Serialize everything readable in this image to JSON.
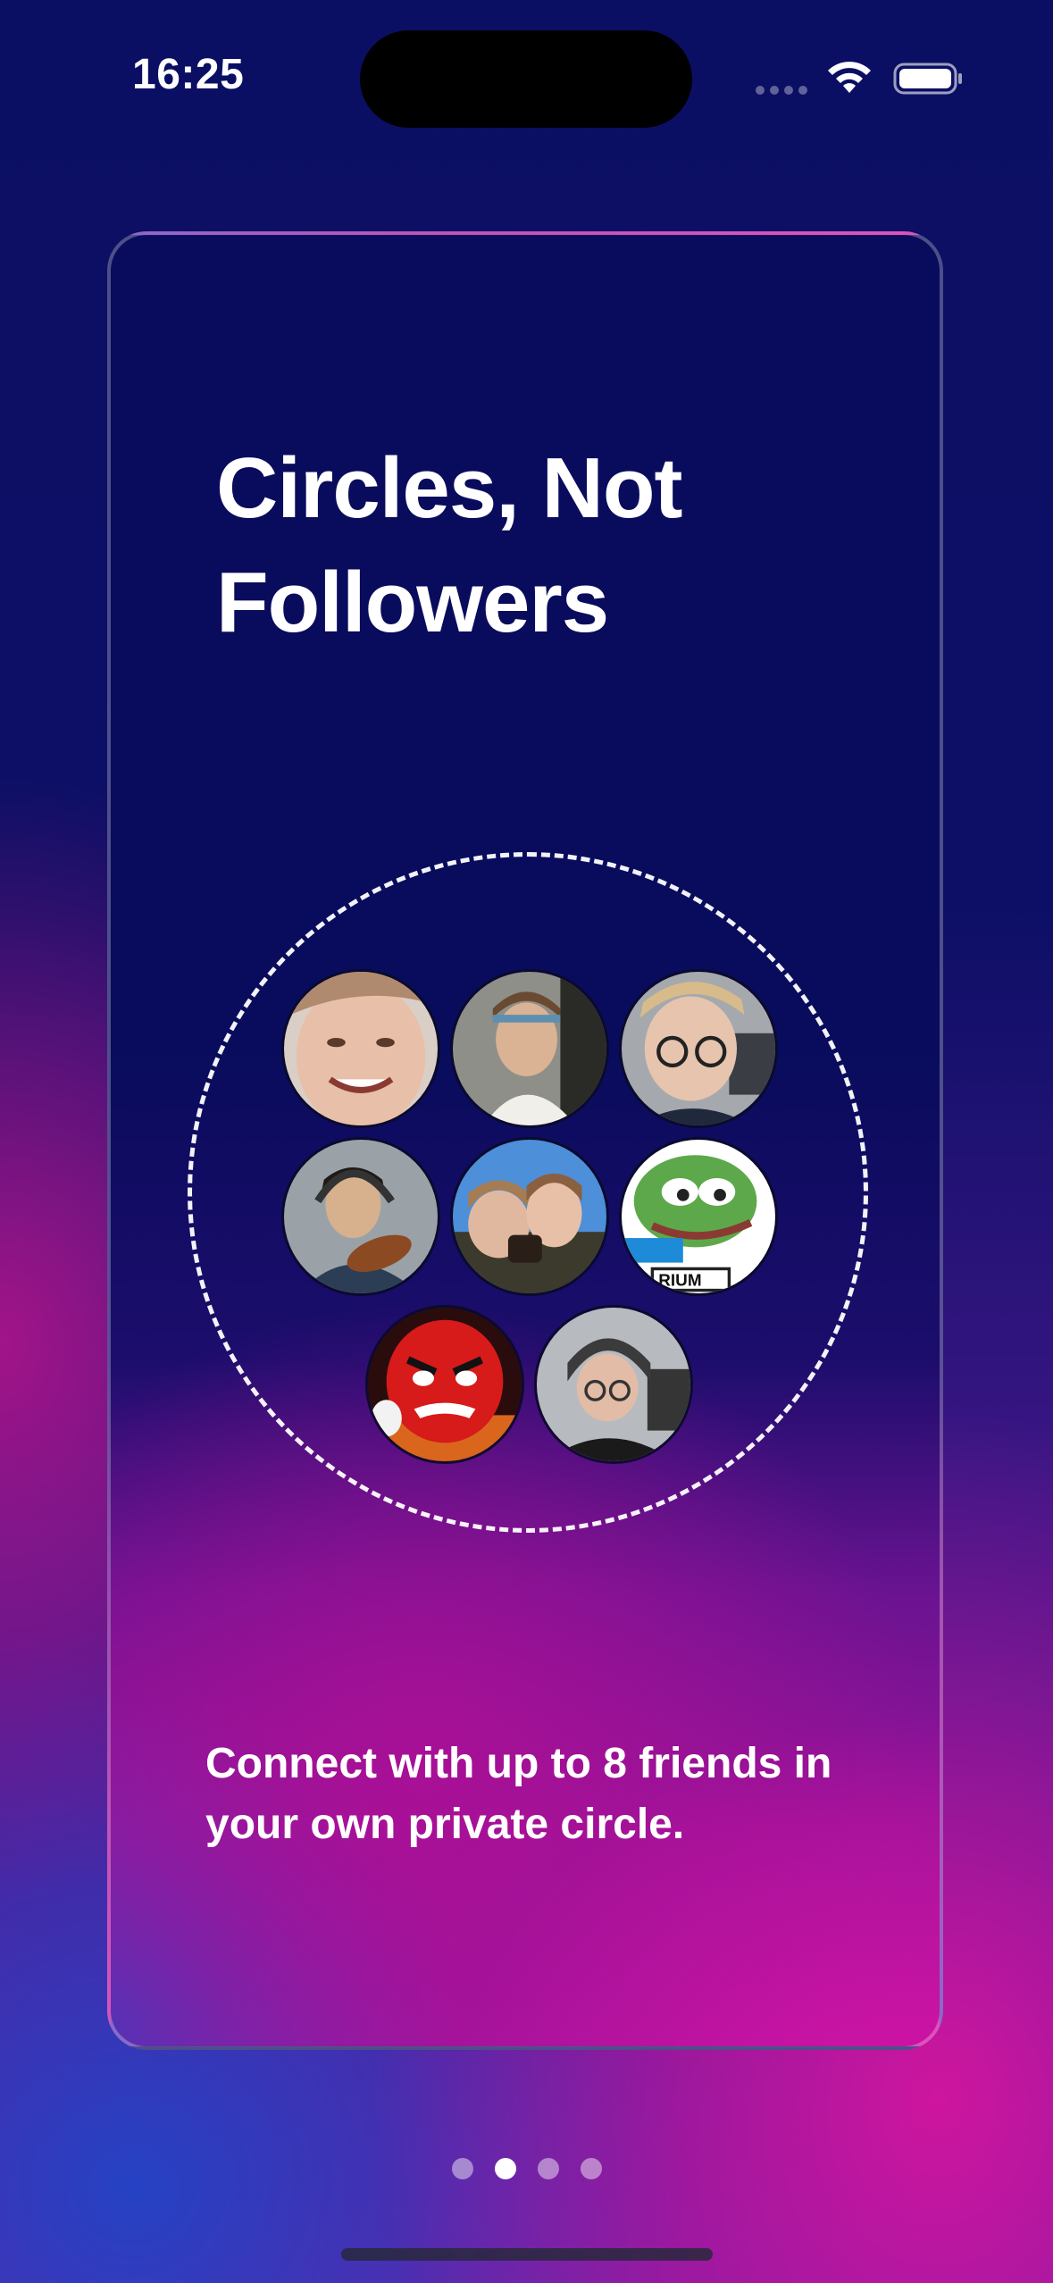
{
  "status_bar": {
    "time": "16:25"
  },
  "onboarding": {
    "title": "Circles, Not Followers",
    "caption": "Connect with up to 8 friends in your own private circle.",
    "avatars": [
      {
        "name": "friend-1"
      },
      {
        "name": "friend-2"
      },
      {
        "name": "friend-3"
      },
      {
        "name": "friend-4"
      },
      {
        "name": "friend-5"
      },
      {
        "name": "friend-6"
      },
      {
        "name": "friend-7"
      },
      {
        "name": "friend-8"
      }
    ],
    "avatar_label_text": "RIUM"
  },
  "pager": {
    "page_count": 4,
    "active_index": 1
  },
  "colors": {
    "background_top": "#0b0f63",
    "accent_magenta": "#dc12a5",
    "accent_blue": "#1e46c8",
    "text": "#ffffff"
  }
}
